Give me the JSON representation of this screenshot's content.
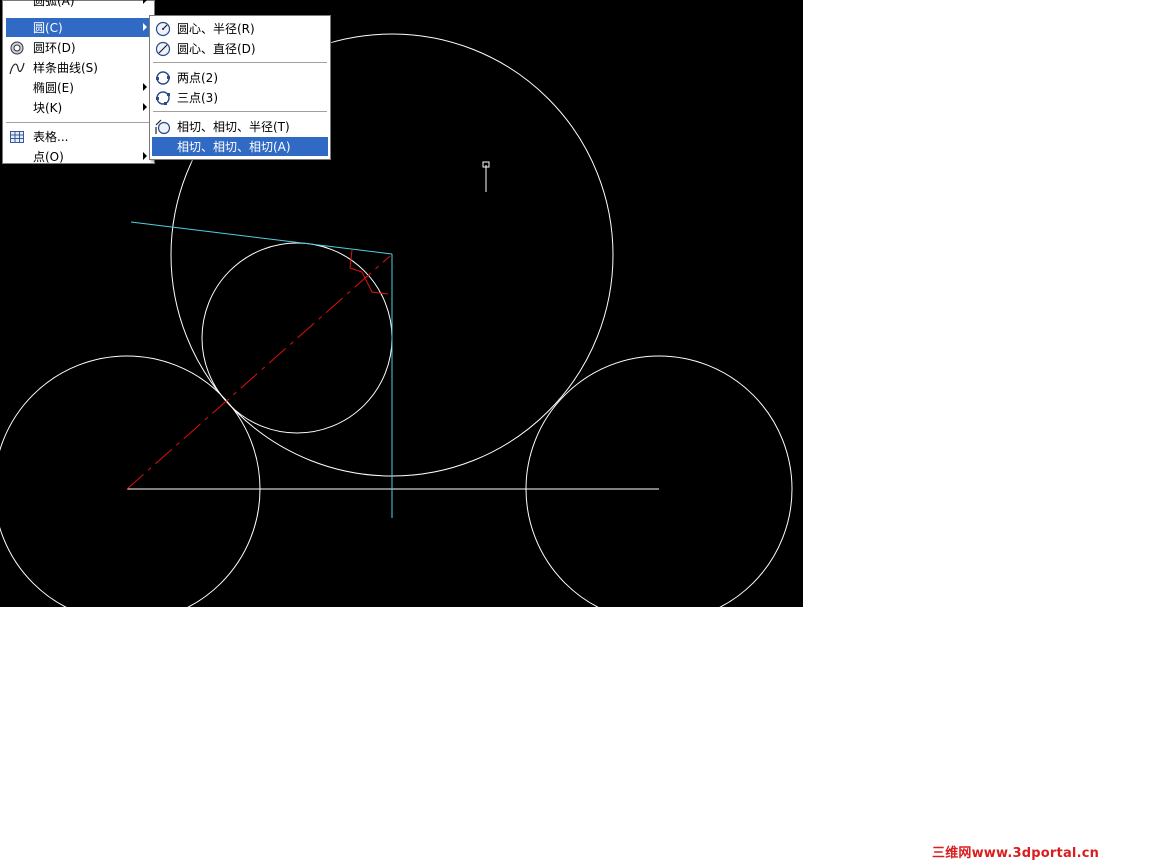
{
  "main_menu": {
    "items": [
      {
        "label": "圆弧(A)",
        "icon": "arc-icon",
        "has_submenu": true
      },
      {
        "label": "圆(C)",
        "icon": "circle-icon",
        "has_submenu": true
      },
      {
        "label": "圆环(D)",
        "icon": "donut-icon",
        "has_submenu": false
      },
      {
        "label": "样条曲线(S)",
        "icon": "spline-icon",
        "has_submenu": false
      },
      {
        "label": "椭圆(E)",
        "icon": "",
        "has_submenu": true
      },
      {
        "label": "块(K)",
        "icon": "",
        "has_submenu": true
      },
      {
        "label": "表格...",
        "icon": "table-icon",
        "has_submenu": false
      },
      {
        "label": "点(O)",
        "icon": "",
        "has_submenu": true
      }
    ]
  },
  "sub_menu": {
    "items": [
      {
        "label": "圆心、半径(R)",
        "icon": "center-radius-icon"
      },
      {
        "label": "圆心、直径(D)",
        "icon": "center-diameter-icon"
      },
      {
        "label": "两点(2)",
        "icon": "two-point-icon"
      },
      {
        "label": "三点(3)",
        "icon": "three-point-icon"
      },
      {
        "label": "相切、相切、半径(T)",
        "icon": "tan-tan-radius-icon"
      },
      {
        "label": "相切、相切、相切(A)",
        "icon": ""
      }
    ],
    "highlighted_index": 5
  },
  "colors": {
    "canvas_bg": "#000000",
    "entity_white": "#ffffff",
    "cyan_lines": "#4fd0e0",
    "red_centerline": "#e01010",
    "menu_highlight": "#316ac5",
    "watermark": "#d81e1e"
  },
  "watermark": {
    "text": "三维网www.3dportal.cn"
  }
}
